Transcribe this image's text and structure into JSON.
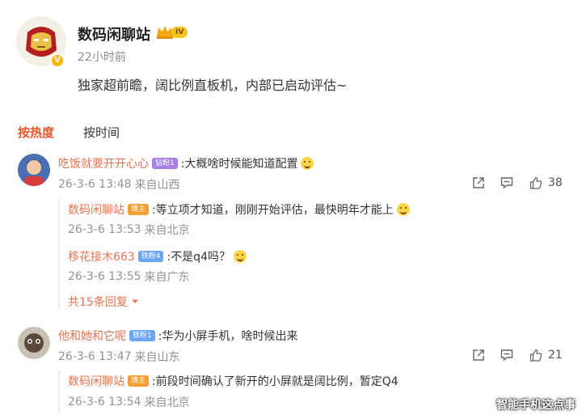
{
  "post": {
    "username": "数码闲聊站",
    "level_badge": "IV",
    "time": "22小时前",
    "text": "独家超前瞻，阔比例直板机，内部已启动评估~"
  },
  "sort_tabs": {
    "hot": "按热度",
    "time": "按时间"
  },
  "comments": [
    {
      "username": "吃饭就要开开心心",
      "badge": "钻粉1",
      "text": ":大概啥时候能知道配置",
      "date": "26-3-6 13:48",
      "location": "来自山西",
      "likes": "38",
      "replies": [
        {
          "username": "数码闲聊站",
          "badge": "博主",
          "text": ":等立项才知道，刚刚开始评估，最快明年才能上",
          "date": "26-3-6 13:53",
          "location": "来自北京"
        },
        {
          "username": "移花接木663",
          "badge": "铁粉4",
          "text": ":不是q4吗？",
          "date": "26-3-6 13:55",
          "location": "来自广东"
        }
      ],
      "more_replies": "共15条回复"
    },
    {
      "username": "他和她和它呢",
      "badge": "铁粉1",
      "text": ":华为小屏手机，啥时候出来",
      "date": "26-3-6 13:47",
      "location": "来自山东",
      "likes": "21",
      "replies": [
        {
          "username": "数码闲聊站",
          "badge": "博主",
          "text": ":前段时间确认了新开的小屏就是阔比例，暂定Q4",
          "date": "26-3-6 13:54",
          "location": "来自北京"
        }
      ]
    }
  ],
  "watermark": "智能手机这点事",
  "colors": {
    "accent": "#eb7350",
    "hot_tab": "#e8562a",
    "meta_gray": "#939393"
  }
}
